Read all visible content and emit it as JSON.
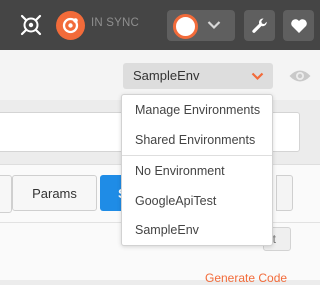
{
  "header": {
    "sync_status": "IN SYNC",
    "icons": {
      "capture": "crosshair-icon",
      "sync": "sync-icon",
      "user": "avatar",
      "settings": "wrench-icon",
      "favorite": "heart-icon"
    }
  },
  "environment": {
    "selected": "SampleEnv",
    "visibility_icon": "eye-icon"
  },
  "menu": {
    "items": [
      {
        "label": "Manage Environments"
      },
      {
        "label": "Shared Environments"
      },
      {
        "label": "No Environment"
      },
      {
        "label": "GoogleApiTest"
      },
      {
        "label": "SampleEnv"
      }
    ]
  },
  "request": {
    "params_label": "Params",
    "send_label": "S",
    "edit_label": "it",
    "generate_code": "Generate Code"
  },
  "colors": {
    "accent": "#f26b3a",
    "primary": "#1f8ce6",
    "header_bg": "#454545"
  }
}
